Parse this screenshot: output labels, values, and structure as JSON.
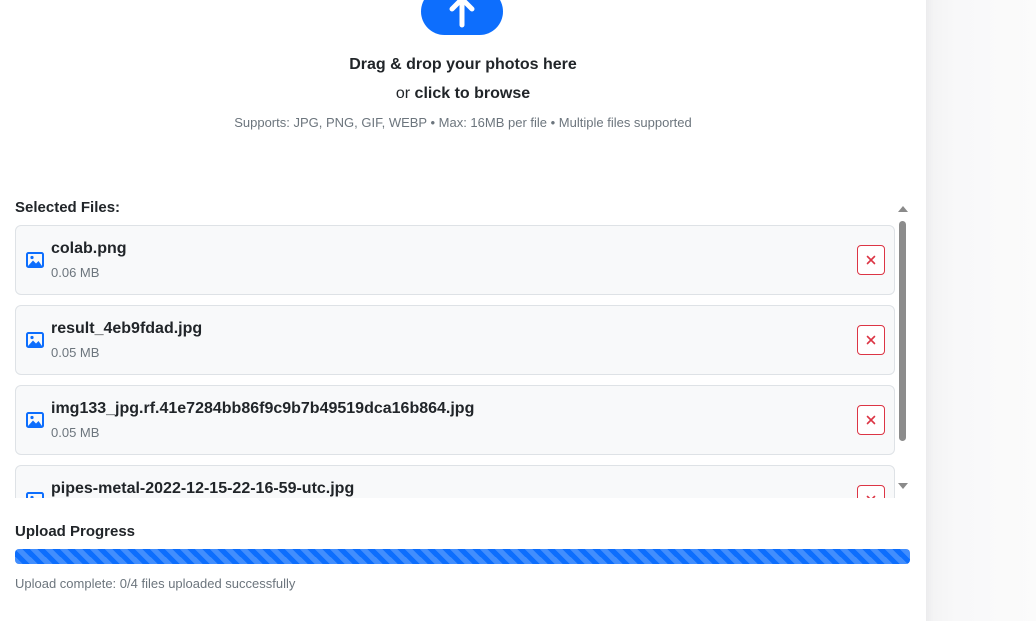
{
  "dropzone": {
    "icon": "cloud-upload-icon",
    "title": "Drag & drop your photos here",
    "browse_prefix": "or",
    "browse_link": "click to browse",
    "supports": "Supports: JPG, PNG, GIF, WEBP • Max: 16MB per file • Multiple files supported"
  },
  "selected_files": {
    "label": "Selected Files:",
    "items": [
      {
        "name": "colab.png",
        "size": "0.06 MB",
        "icon": "image-icon"
      },
      {
        "name": "result_4eb9fdad.jpg",
        "size": "0.05 MB",
        "icon": "image-icon"
      },
      {
        "name": "img133_jpg.rf.41e7284bb86f9c9b7b49519dca16b864.jpg",
        "size": "0.05 MB",
        "icon": "image-icon"
      },
      {
        "name": "pipes-metal-2022-12-15-22-16-59-utc.jpg",
        "size": "",
        "icon": "image-icon"
      }
    ],
    "remove_symbol": "×"
  },
  "progress": {
    "title": "Upload Progress",
    "percent": 100,
    "status": "Upload complete: 0/4 files uploaded successfully"
  },
  "colors": {
    "accent": "#0d6efd",
    "danger": "#dc3545",
    "muted": "#6c757d"
  }
}
